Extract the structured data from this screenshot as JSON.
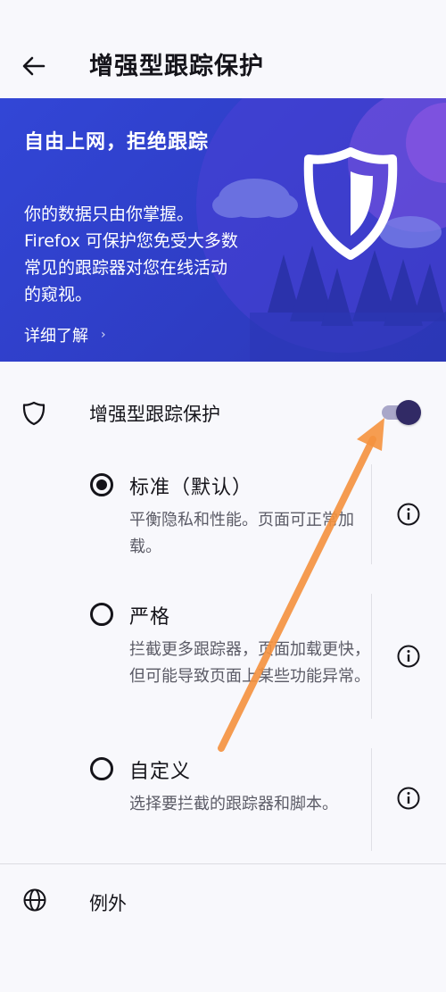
{
  "appbar": {
    "title": "增强型跟踪保护"
  },
  "banner": {
    "title": "自由上网，拒绝跟踪",
    "text": "你的数据只由你掌握。Firefox 可保护您免受大多数常见的跟踪器对您在线活动的窥视。",
    "learn_more": "详细了解",
    "learn_more_chevron": "›"
  },
  "etp": {
    "label": "增强型跟踪保护",
    "enabled": true
  },
  "options": [
    {
      "title": "标准（默认）",
      "description": "平衡隐私和性能。页面可正常加载。",
      "selected": true
    },
    {
      "title": "严格",
      "description": "拦截更多跟踪器，页面加载更快，但可能导致页面上某些功能异常。",
      "selected": false
    },
    {
      "title": "自定义",
      "description": "选择要拦截的跟踪器和脚本。",
      "selected": false
    }
  ],
  "exceptions": {
    "label": "例外"
  },
  "colors": {
    "banner": "#3246d6",
    "toggle_thumb": "#312a65",
    "toggle_track": "#a9a7c9",
    "annotation_arrow": "#f5923e"
  },
  "icons": [
    "back-arrow-icon",
    "shield-icon",
    "info-icon",
    "globe-icon",
    "chevron-right-icon"
  ]
}
